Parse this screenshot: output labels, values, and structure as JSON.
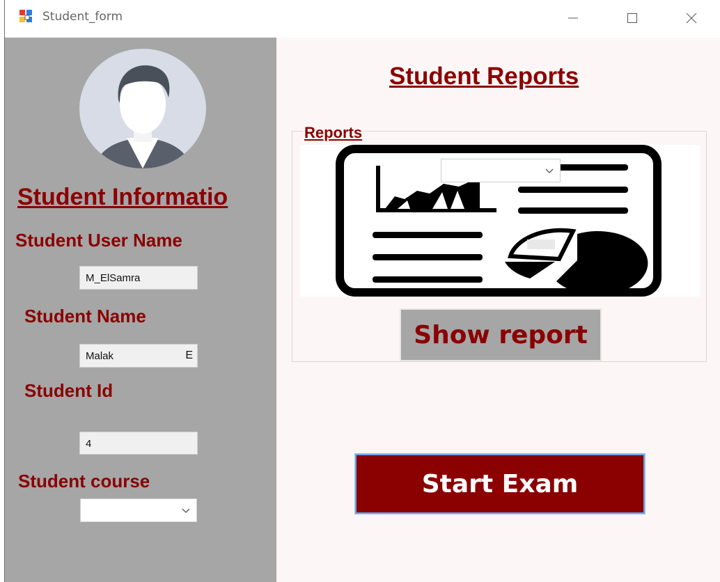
{
  "window": {
    "title": "Student_form",
    "icon": "winforms-app-icon",
    "controls": [
      "minimize-icon",
      "maximize-icon",
      "close-icon"
    ]
  },
  "student_info": {
    "heading": "Student Informatio",
    "username_label": "Student User Name",
    "username_value": "M_ElSamra",
    "name_label": "Student Name",
    "name_value": "Malak",
    "name_value_tail": "E",
    "id_label": "Student Id",
    "id_value": "4",
    "course_label": "Student course",
    "course_selected": ""
  },
  "reports": {
    "title": "Student Reports",
    "group_label": "Reports",
    "report_selected": "",
    "show_button": "Show report",
    "start_button": "Start Exam"
  },
  "colors": {
    "accent": "#8b0000",
    "left_panel": "#a6a6a6",
    "right_panel": "#fdf6f6",
    "focus_border": "#6aa5e6"
  }
}
